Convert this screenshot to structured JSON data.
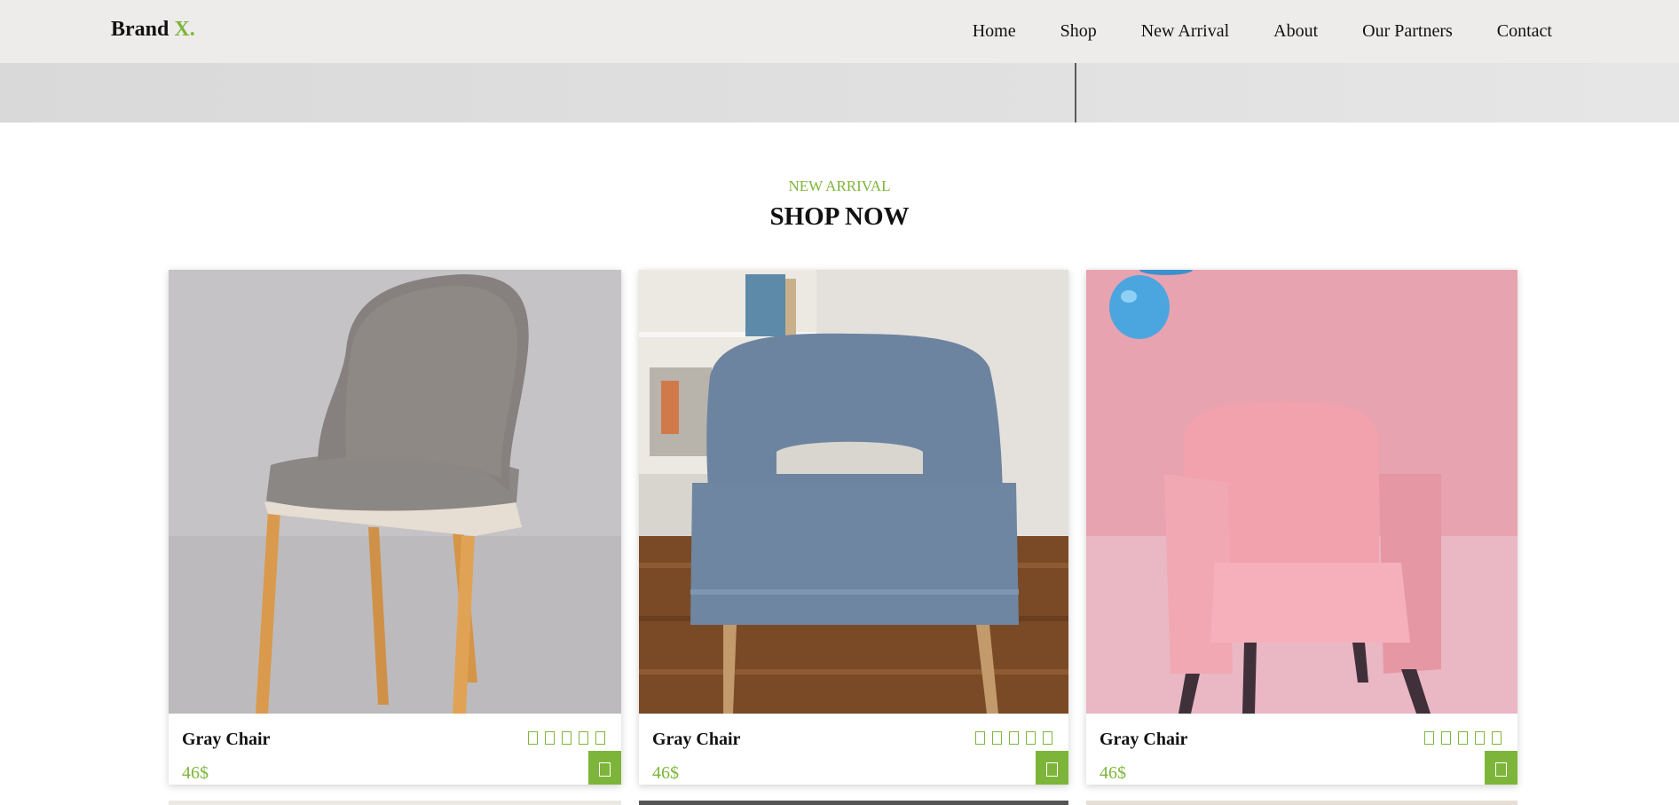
{
  "brand": {
    "name": "Brand",
    "accent": "X."
  },
  "nav": {
    "items": [
      {
        "label": "Home"
      },
      {
        "label": "Shop"
      },
      {
        "label": "New Arrival"
      },
      {
        "label": "About"
      },
      {
        "label": "Our Partners"
      },
      {
        "label": "Contact"
      }
    ]
  },
  "section": {
    "eyebrow": "NEW ARRIVAL",
    "title": "SHOP NOW"
  },
  "products": [
    {
      "name": "Gray Chair",
      "price": "46$",
      "rating_stars": 5,
      "photo": "gray fabric chair with wooden legs on gray background"
    },
    {
      "name": "Gray Chair",
      "price": "46$",
      "rating_stars": 5,
      "photo": "blue upholstered armchair on wooden floor"
    },
    {
      "name": "Gray Chair",
      "price": "46$",
      "rating_stars": 5,
      "photo": "pink tufted armchair on pink background with blue balloon"
    }
  ],
  "colors": {
    "accent": "#7db53a",
    "header_bg": "#edecea",
    "text": "#111111"
  },
  "icons": {
    "cart": "cart-icon",
    "star": "star-icon"
  }
}
